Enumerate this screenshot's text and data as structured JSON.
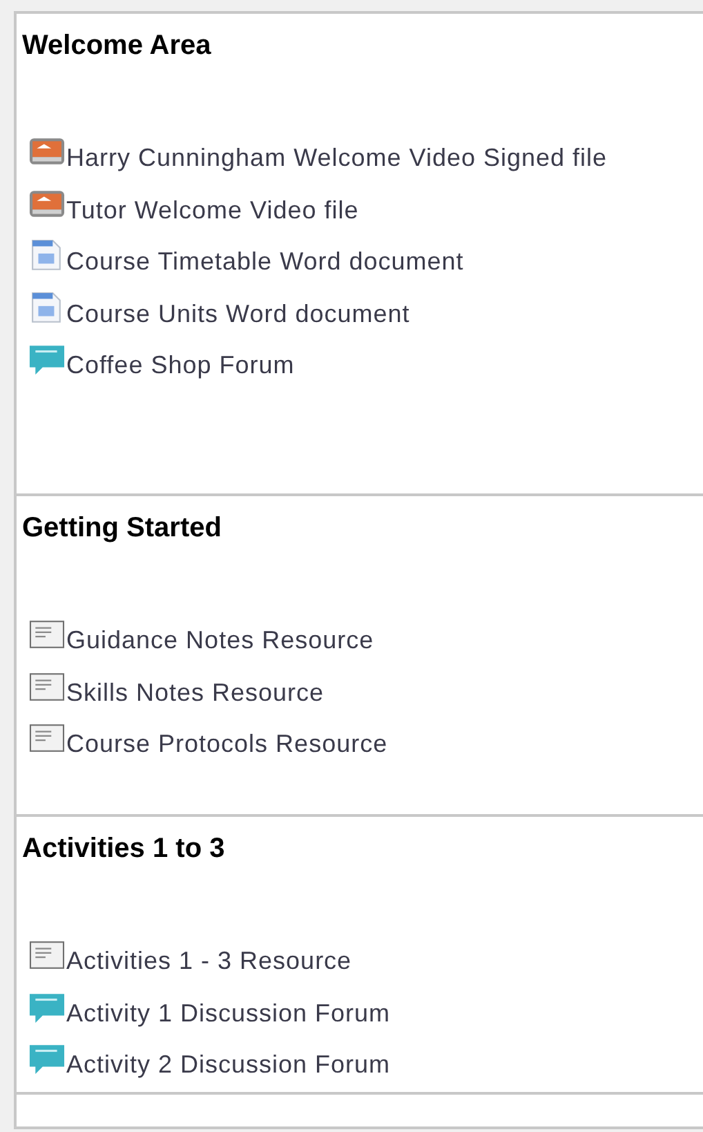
{
  "sections": [
    {
      "title": "Welcome Area",
      "items": [
        {
          "kind": "video",
          "label": "Harry Cunningham Welcome Video Signed file"
        },
        {
          "kind": "video",
          "label": "Tutor Welcome Video file"
        },
        {
          "kind": "word",
          "label": "Course Timetable Word document"
        },
        {
          "kind": "word",
          "label": "Course Units Word document"
        },
        {
          "kind": "forum",
          "label": "Coffee Shop Forum"
        }
      ]
    },
    {
      "title": "Getting Started",
      "items": [
        {
          "kind": "resource",
          "label": "Guidance Notes Resource"
        },
        {
          "kind": "resource",
          "label": "Skills Notes Resource"
        },
        {
          "kind": "resource",
          "label": "Course Protocols Resource"
        }
      ]
    },
    {
      "title": "Activities 1 to 3",
      "items": [
        {
          "kind": "resource",
          "label": "Activities 1 - 3 Resource"
        },
        {
          "kind": "forum",
          "label": "Activity 1 Discussion Forum"
        },
        {
          "kind": "forum",
          "label": "Activity 2 Discussion Forum"
        }
      ]
    }
  ]
}
